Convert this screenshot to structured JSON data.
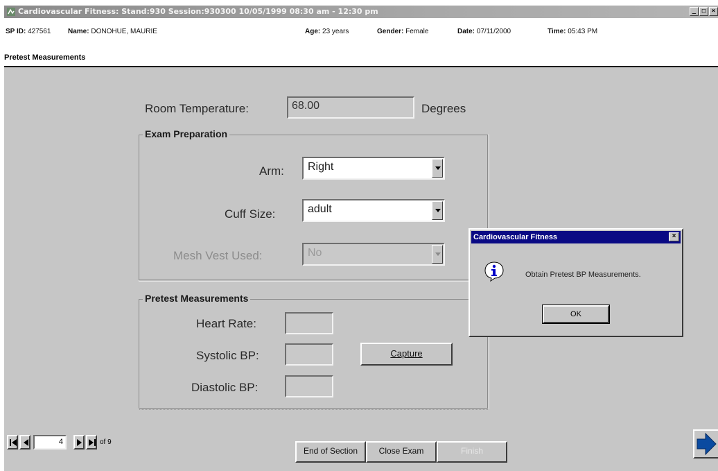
{
  "window": {
    "title": "Cardiovascular Fitness: Stand:930 Session:930300 10/05/1999 08:30 am - 12:30 pm",
    "buttons": [
      "_",
      "□",
      "×"
    ]
  },
  "info": {
    "sp_id_label": "SP ID:",
    "sp_id": "427561",
    "name_label": "Name:",
    "name": "DONOHUE, MAURIE",
    "age_label": "Age:",
    "age": "23 years",
    "gender_label": "Gender:",
    "gender": "Female",
    "date_label": "Date:",
    "date": "07/11/2000",
    "time_label": "Time:",
    "time": "05:43 PM"
  },
  "section": {
    "title": "Pretest Measurements"
  },
  "room_temperature": {
    "label": "Room Temperature:",
    "value": "68.00",
    "unit": "Degrees"
  },
  "exam_preparation": {
    "title": "Exam Preparation",
    "arm": {
      "label": "Arm:",
      "value": "Right"
    },
    "cuff_size": {
      "label": "Cuff Size:",
      "value": "adult"
    },
    "mesh_vest": {
      "label": "Mesh Vest Used:",
      "value": "No"
    }
  },
  "pretest": {
    "title": "Pretest Measurements",
    "heart_rate_label": "Heart Rate:",
    "systolic_label": "Systolic BP:",
    "diastolic_label": "Diastolic BP:",
    "capture_label": "Capture"
  },
  "dialog": {
    "title": "Cardiovascular Fitness",
    "close": "×",
    "message": "Obtain Pretest BP Measurements.",
    "ok": "OK",
    "icon": "info-icon"
  },
  "navigation": {
    "page": "4",
    "of_text": "of 9",
    "end_of_section": "End of Section",
    "close_exam": "Close Exam",
    "finish": "Finish"
  },
  "colors": {
    "panel": "#c6c6c6",
    "dialog_title": "#0a0a84",
    "next_arrow": "#0a4aa0"
  }
}
